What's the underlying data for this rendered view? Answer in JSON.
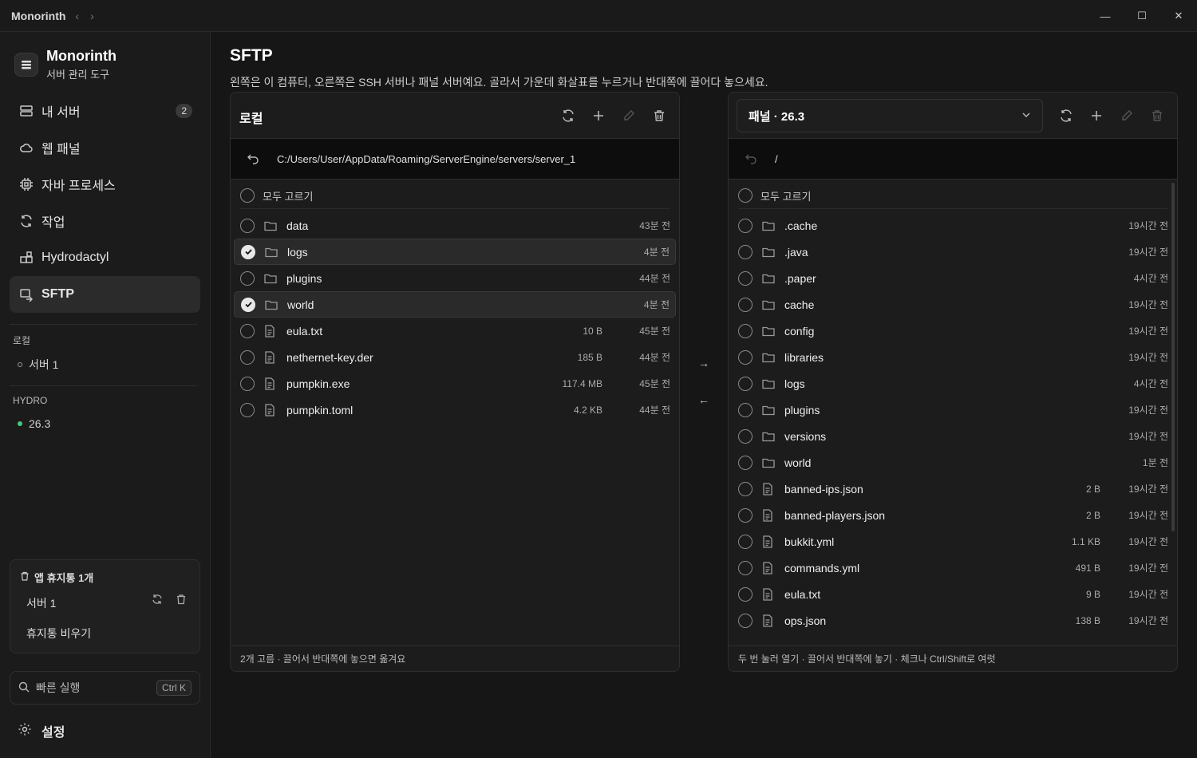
{
  "window": {
    "app_name": "Monorinth",
    "nav_back": "‹",
    "nav_forward": "›",
    "minimize": "—",
    "maximize": "☐",
    "close": "✕"
  },
  "sidebar": {
    "brand_title": "Monorinth",
    "brand_subtitle": "서버 관리 도구",
    "items": [
      {
        "label": "내 서버",
        "icon": "server-icon",
        "badge": "2"
      },
      {
        "label": "웹 패널",
        "icon": "cloud-icon"
      },
      {
        "label": "자바 프로세스",
        "icon": "cpu-icon"
      },
      {
        "label": "작업",
        "icon": "refresh-icon"
      },
      {
        "label": "Hydrodactyl",
        "icon": "blocks-icon"
      },
      {
        "label": "SFTP",
        "icon": "sftp-icon",
        "active": true
      }
    ],
    "local_label": "로컬",
    "local_server": "서버 1",
    "hydro_label": "HYDRO",
    "hydro_server": "26.3",
    "hydro_status_color": "#3fcf6e",
    "trash": {
      "title": "앱 휴지통 1개",
      "item": "서버 1",
      "empty_label": "휴지통 비우기"
    },
    "quick_run": {
      "label": "빠른 실행",
      "shortcut": "Ctrl K"
    },
    "settings_label": "설정"
  },
  "main": {
    "title": "SFTP",
    "description": "왼쪽은 이 컴퓨터, 오른쪽은 SSH 서버나 패널 서버예요. 골라서 가운데 화살표를 누르거나 반대쪽에 끌어다 놓으세요.",
    "left_panel": {
      "title": "로컬",
      "path": "C:/Users/User/AppData/Roaming/ServerEngine/servers/server_1",
      "select_all": "모두 고르기",
      "files": [
        {
          "name": "data",
          "type": "folder",
          "size": "",
          "time": "43분 전",
          "checked": false
        },
        {
          "name": "logs",
          "type": "folder",
          "size": "",
          "time": "4분 전",
          "checked": true
        },
        {
          "name": "plugins",
          "type": "folder",
          "size": "",
          "time": "44분 전",
          "checked": false
        },
        {
          "name": "world",
          "type": "folder",
          "size": "",
          "time": "4분 전",
          "checked": true
        },
        {
          "name": "eula.txt",
          "type": "file",
          "size": "10 B",
          "time": "45분 전",
          "checked": false
        },
        {
          "name": "nethernet-key.der",
          "type": "file",
          "size": "185 B",
          "time": "44분 전",
          "checked": false
        },
        {
          "name": "pumpkin.exe",
          "type": "file",
          "size": "117.4 MB",
          "time": "45분 전",
          "checked": false
        },
        {
          "name": "pumpkin.toml",
          "type": "file",
          "size": "4.2 KB",
          "time": "44분 전",
          "checked": false
        }
      ],
      "footer": "2개 고름 · 끌어서 반대쪽에 놓으면 옮겨요"
    },
    "right_panel": {
      "selected_server": "패널 · 26.3",
      "path": "/",
      "select_all": "모두 고르기",
      "files": [
        {
          "name": ".cache",
          "type": "folder",
          "size": "",
          "time": "19시간 전"
        },
        {
          "name": ".java",
          "type": "folder",
          "size": "",
          "time": "19시간 전"
        },
        {
          "name": ".paper",
          "type": "folder",
          "size": "",
          "time": "4시간 전"
        },
        {
          "name": "cache",
          "type": "folder",
          "size": "",
          "time": "19시간 전"
        },
        {
          "name": "config",
          "type": "folder",
          "size": "",
          "time": "19시간 전"
        },
        {
          "name": "libraries",
          "type": "folder",
          "size": "",
          "time": "19시간 전"
        },
        {
          "name": "logs",
          "type": "folder",
          "size": "",
          "time": "4시간 전"
        },
        {
          "name": "plugins",
          "type": "folder",
          "size": "",
          "time": "19시간 전"
        },
        {
          "name": "versions",
          "type": "folder",
          "size": "",
          "time": "19시간 전"
        },
        {
          "name": "world",
          "type": "folder",
          "size": "",
          "time": "1분 전"
        },
        {
          "name": "banned-ips.json",
          "type": "file",
          "size": "2 B",
          "time": "19시간 전"
        },
        {
          "name": "banned-players.json",
          "type": "file",
          "size": "2 B",
          "time": "19시간 전"
        },
        {
          "name": "bukkit.yml",
          "type": "file",
          "size": "1.1 KB",
          "time": "19시간 전"
        },
        {
          "name": "commands.yml",
          "type": "file",
          "size": "491 B",
          "time": "19시간 전"
        },
        {
          "name": "eula.txt",
          "type": "file",
          "size": "9 B",
          "time": "19시간 전"
        },
        {
          "name": "ops.json",
          "type": "file",
          "size": "138 B",
          "time": "19시간 전"
        }
      ],
      "footer": "두 번 눌러 열기 · 끌어서 반대쪽에 놓기 · 체크나 Ctrl/Shift로 여럿"
    },
    "transfer": {
      "to_remote": "→",
      "to_local": "←"
    }
  }
}
